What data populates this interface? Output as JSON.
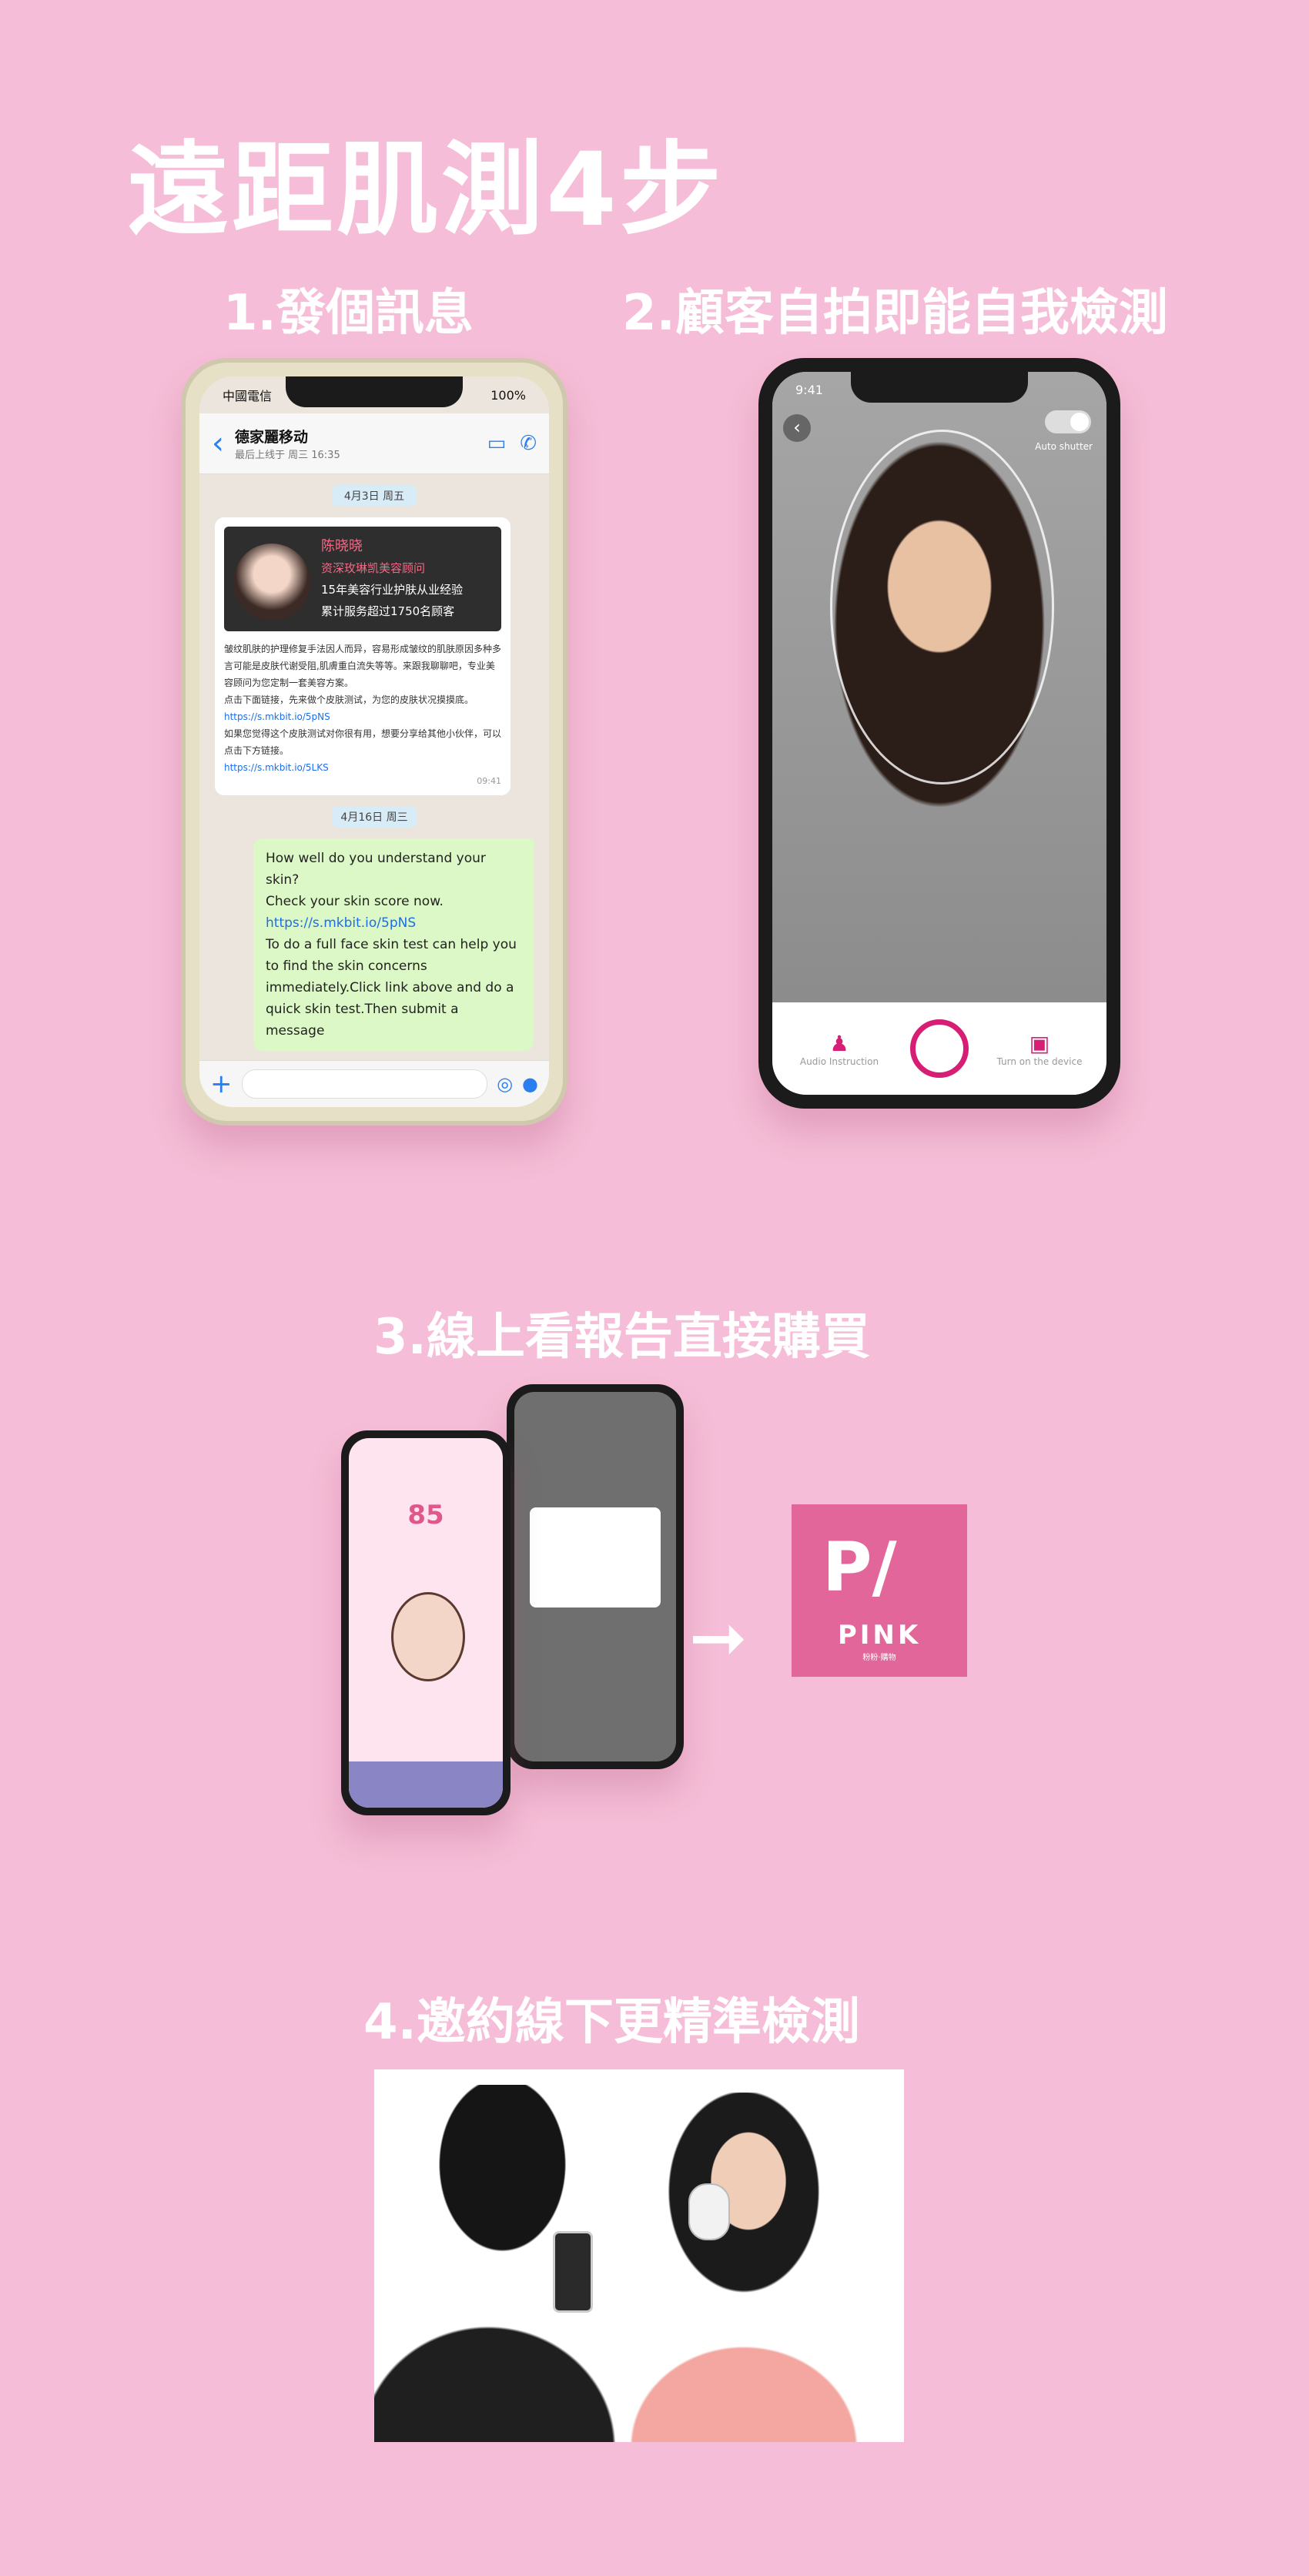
{
  "title": "遠距肌測4步",
  "steps": [
    {
      "label": "1.發個訊息"
    },
    {
      "label": "2.顧客自拍即能自我檢測"
    },
    {
      "label": "3.線上看報告直接購買"
    },
    {
      "label": "4.邀約線下更精準檢測"
    }
  ],
  "chat": {
    "carrier": "中國電信",
    "battery": "100%",
    "contact_name": "德家麗移动",
    "contact_status": "最后上线于 周三 16:35",
    "date1": "4月3日 周五",
    "card_name": "陈晓晓",
    "card_role": "资深玫琳凯美容顾问",
    "card_line1": "15年美容行业护肤从业经验",
    "card_line2": "累计服务超过1750名顾客",
    "msg1_p1": "皱纹肌肤的护理修复手法因人而异，容易形成皱纹的肌肤原因多种多言可能是皮肤代谢受阻,肌膚重白流失等等。来跟我聊聊吧，专业美容顾问为您定制一套美容方案。",
    "msg1_p2": "点击下面链接，先来做个皮肤测试，为您的皮肤状况摸摸底。",
    "msg1_link1": "https://s.mkbit.io/5pNS",
    "msg1_p3": "如果您觉得这个皮肤测试对你很有用，想要分享给其他小伙伴，可以点击下方链接。",
    "msg1_link2": "https://s.mkbit.io/5LKS",
    "msg1_time": "09:41",
    "date2": "4月16日 周三",
    "msg2_line1": "How well do you understand your skin?",
    "msg2_line2": "Check your skin score now.",
    "msg2_link": "https://s.mkbit.io/5pNS",
    "msg2_line3": "To do a full face skin test can help you to find the skin concerns immediately.Click  link above and do a quick skin test.Then submit a message"
  },
  "selfie": {
    "time": "9:41",
    "auto_shutter": "Auto shutter",
    "audio_label": "Audio Instruction",
    "device_label": "Turn on the device"
  },
  "report": {
    "score": "85"
  },
  "logo": {
    "word": "PINK",
    "sub": "粉粉·購物"
  }
}
